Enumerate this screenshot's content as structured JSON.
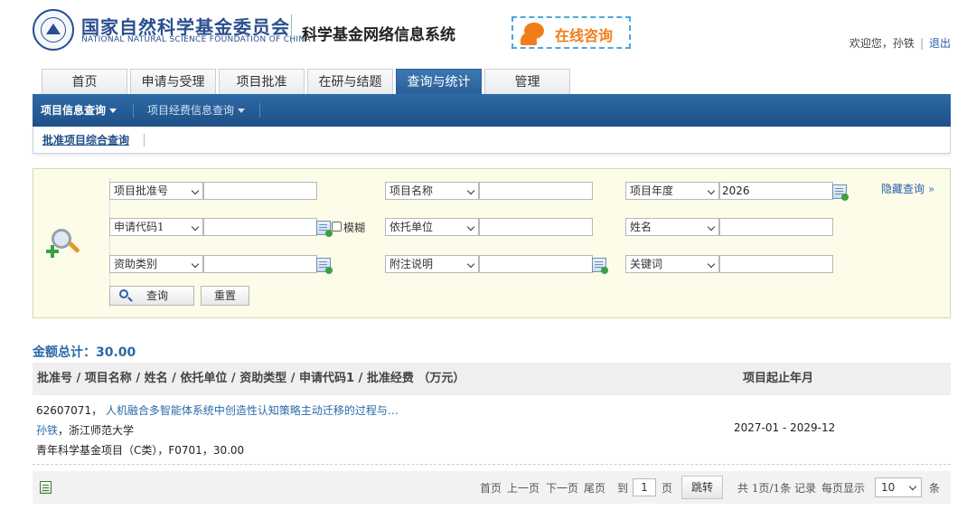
{
  "header": {
    "org_cn": "国家自然科学基金委员会",
    "org_en": "NATIONAL NATURAL SCIENCE FOUNDATION OF CHINA",
    "system_title": "科学基金网络信息系统",
    "consult_label": "在线咨询",
    "welcome": "欢迎您，孙铁",
    "logout": "退出"
  },
  "tabs": [
    {
      "label": "首页"
    },
    {
      "label": "申请与受理"
    },
    {
      "label": "项目批准"
    },
    {
      "label": "在研与结题"
    },
    {
      "label": "查询与统计",
      "active": true
    },
    {
      "label": "管理"
    }
  ],
  "subnav": {
    "items": [
      {
        "label": "项目信息查询",
        "active": true
      },
      {
        "label": "项目经费信息查询"
      }
    ]
  },
  "subtab": {
    "label": "批准项目综合查询"
  },
  "search": {
    "hide_label": "隐藏查询 »",
    "row1": {
      "field1": {
        "select": "项目批准号",
        "value": ""
      },
      "field2": {
        "select": "项目名称",
        "value": ""
      },
      "field3": {
        "select": "项目年度",
        "value": "2026"
      }
    },
    "row2": {
      "field1": {
        "select": "申请代码1",
        "value": ""
      },
      "fuzzy_label": "模糊",
      "field2": {
        "select": "依托单位",
        "value": ""
      },
      "field3": {
        "select": "姓名",
        "value": ""
      }
    },
    "row3": {
      "field1": {
        "select": "资助类别",
        "value": ""
      },
      "field2": {
        "select": "附注说明",
        "value": ""
      },
      "field3": {
        "select": "关键词",
        "value": ""
      }
    },
    "search_button": "查询",
    "reset_button": "重置"
  },
  "results": {
    "total_label": "金额总计：30.00",
    "columns": {
      "main": "批准号 / 项目名称 / 姓名 / 依托单位 / 资助类型 / 申请代码1 / 批准经费 （万元）",
      "dates": "项目起止年月"
    },
    "rows": [
      {
        "id_prefix": "62607071，",
        "title": "人机融合多智能体系统中创造性认知策略主动迁移的过程与…",
        "person": "孙铁",
        "org_suffix": "，浙江师范大学",
        "detail": "青年科学基金项目（C类），F0701，30.00",
        "dates": "2027-01 - 2029-12"
      }
    ]
  },
  "pager": {
    "first": "首页",
    "prev": "上一页",
    "next": "下一页",
    "last": "尾页",
    "goto_prefix": "到",
    "page_value": "1",
    "goto_suffix": "页",
    "jump": "跳转",
    "summary": "共 1页/1条 记录",
    "per_page_label": "每页显示",
    "per_page_value": "10",
    "per_page_suffix": "条"
  }
}
